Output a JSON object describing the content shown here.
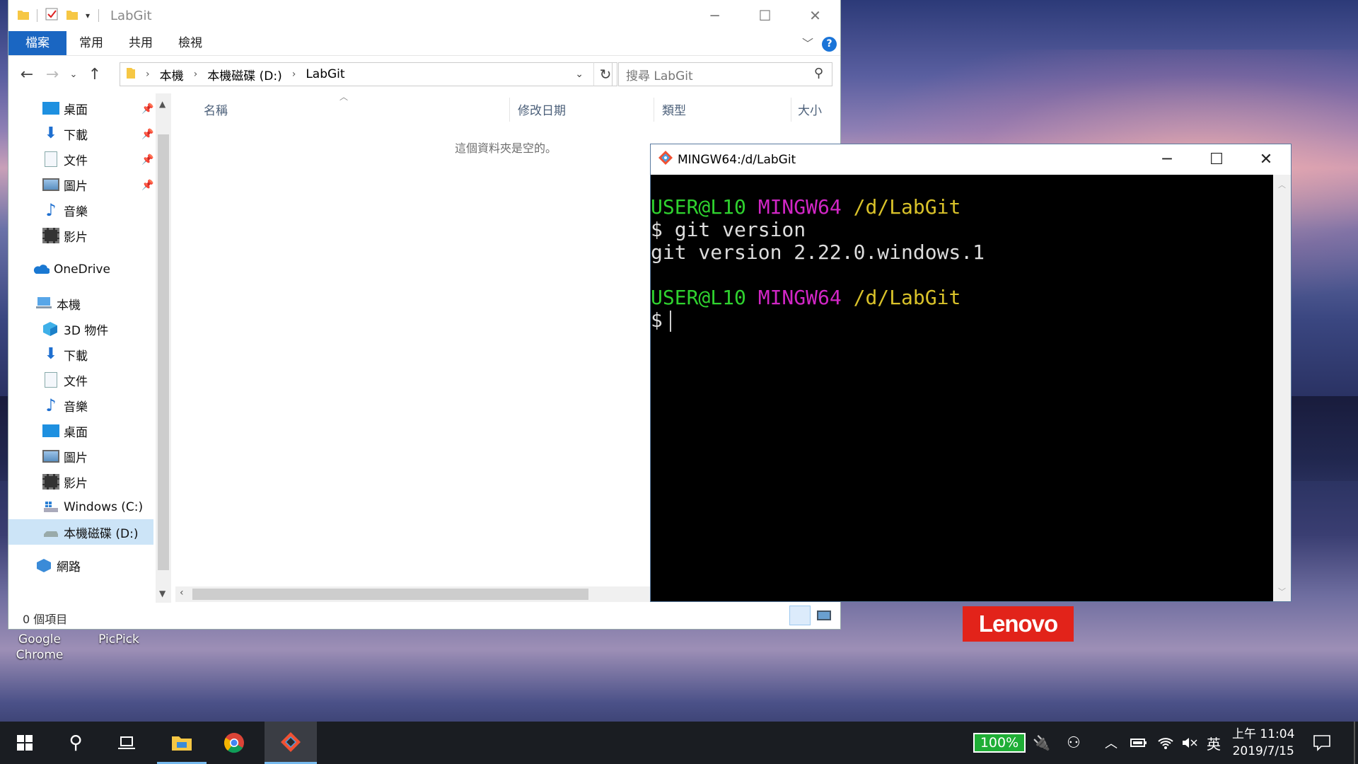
{
  "explorer": {
    "title": "LabGit",
    "ribbon_tabs": [
      "檔案",
      "常用",
      "共用",
      "檢視"
    ],
    "help": "?",
    "breadcrumb": [
      "本機",
      "本機磁碟 (D:)",
      "LabGit"
    ],
    "search_placeholder": "搜尋 LabGit",
    "nav": {
      "quick": [
        "桌面",
        "下載",
        "文件",
        "圖片",
        "音樂",
        "影片"
      ],
      "onedrive": "OneDrive",
      "pc": "本機",
      "pc_items": [
        "3D 物件",
        "下載",
        "文件",
        "音樂",
        "桌面",
        "圖片",
        "影片",
        "Windows (C:)",
        "本機磁碟 (D:)"
      ],
      "network": "網路"
    },
    "columns": [
      "名稱",
      "修改日期",
      "類型",
      "大小"
    ],
    "empty_text": "這個資料夾是空的。",
    "status": "0 個項目"
  },
  "terminal": {
    "title": "MINGW64:/d/LabGit",
    "prompt_user": "USER@L10",
    "prompt_env": "MINGW64",
    "prompt_path": "/d/LabGit",
    "command": "$ git version",
    "output": "git version 2.22.0.windows.1",
    "prompt2": "$"
  },
  "desktop": {
    "icons": [
      {
        "line1": "Google",
        "line2": "Chrome"
      },
      {
        "line1": "PicPick",
        "line2": ""
      }
    ],
    "logo": "Lenovo"
  },
  "taskbar": {
    "battery": "100%",
    "ime": "英",
    "time": "上午 11:04",
    "date": "2019/7/15"
  }
}
